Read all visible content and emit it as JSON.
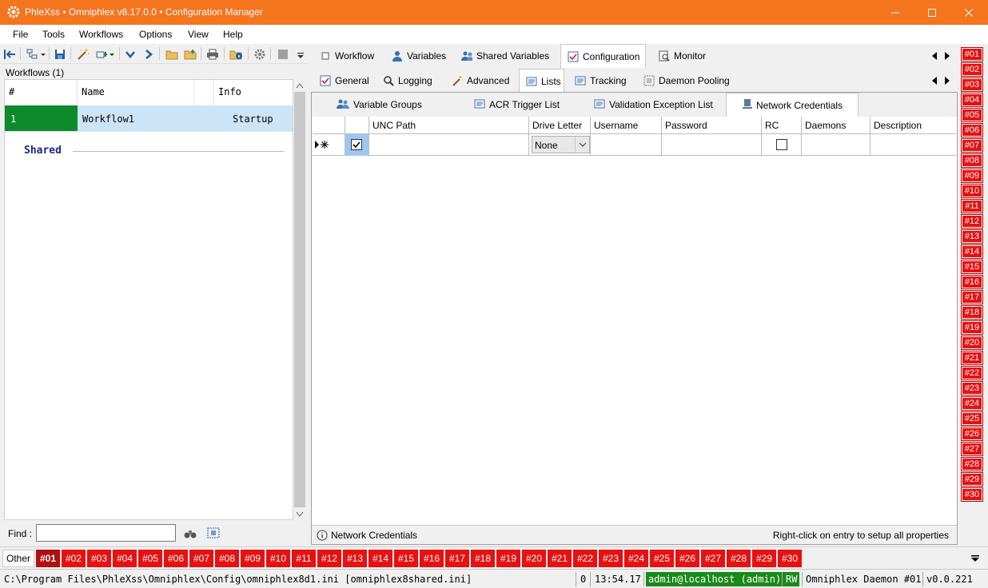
{
  "window": {
    "title": "PhleXss • Omniphlex v8.17.0.0 • Configuration Manager"
  },
  "menu": [
    "File",
    "Tools",
    "Workflows",
    "Options",
    "View",
    "Help"
  ],
  "workflows": {
    "label": "Workflows (1)",
    "columns": [
      "#",
      "Name",
      "Info"
    ],
    "rows": [
      {
        "num": "1",
        "name": "Workflow1",
        "info": "Startup"
      }
    ],
    "shared_label": "Shared",
    "find_label": "Find :",
    "find_value": ""
  },
  "main_tabs": [
    "Workflow",
    "Variables",
    "Shared Variables",
    "Configuration",
    "Monitor"
  ],
  "config_tabs": [
    "General",
    "Logging",
    "Advanced",
    "Lists",
    "Tracking",
    "Daemon Pooling"
  ],
  "list_tabs": [
    "Variable Groups",
    "ACR Trigger List",
    "Validation Exception List",
    "Network Credentials"
  ],
  "grid": {
    "columns": [
      "UNC Path",
      "Drive Letter",
      "Username",
      "Password",
      "RC",
      "Daemons",
      "Description"
    ],
    "new_row": {
      "drive_letter": "None"
    }
  },
  "footer": {
    "left": "Network Credentials",
    "right": "Right-click on entry to setup all properties"
  },
  "daemons": [
    "#01",
    "#02",
    "#03",
    "#04",
    "#05",
    "#06",
    "#07",
    "#08",
    "#09",
    "#10",
    "#11",
    "#12",
    "#13",
    "#14",
    "#15",
    "#16",
    "#17",
    "#18",
    "#19",
    "#20",
    "#21",
    "#22",
    "#23",
    "#24",
    "#25",
    "#26",
    "#27",
    "#28",
    "#29",
    "#30"
  ],
  "bottom_tabs": {
    "other": "Other"
  },
  "status": {
    "path": "C:\\Program Files\\PhleXss\\Omniphlex\\Config\\omniphlex8d1.ini [omniphlex8shared.ini]",
    "count": "0",
    "time": "13:54.17",
    "user": "admin@localhost (admin)",
    "mode": "RW",
    "daemon": "Omniphlex Daemon #01",
    "version": "v0.0.221"
  },
  "colors": {
    "titlebar": "#f5741e",
    "daemon_badge": "#e81010",
    "status_green": "#1a8a1a",
    "selected_row": "#cce4f7",
    "row_number": "#0d8a2c"
  }
}
